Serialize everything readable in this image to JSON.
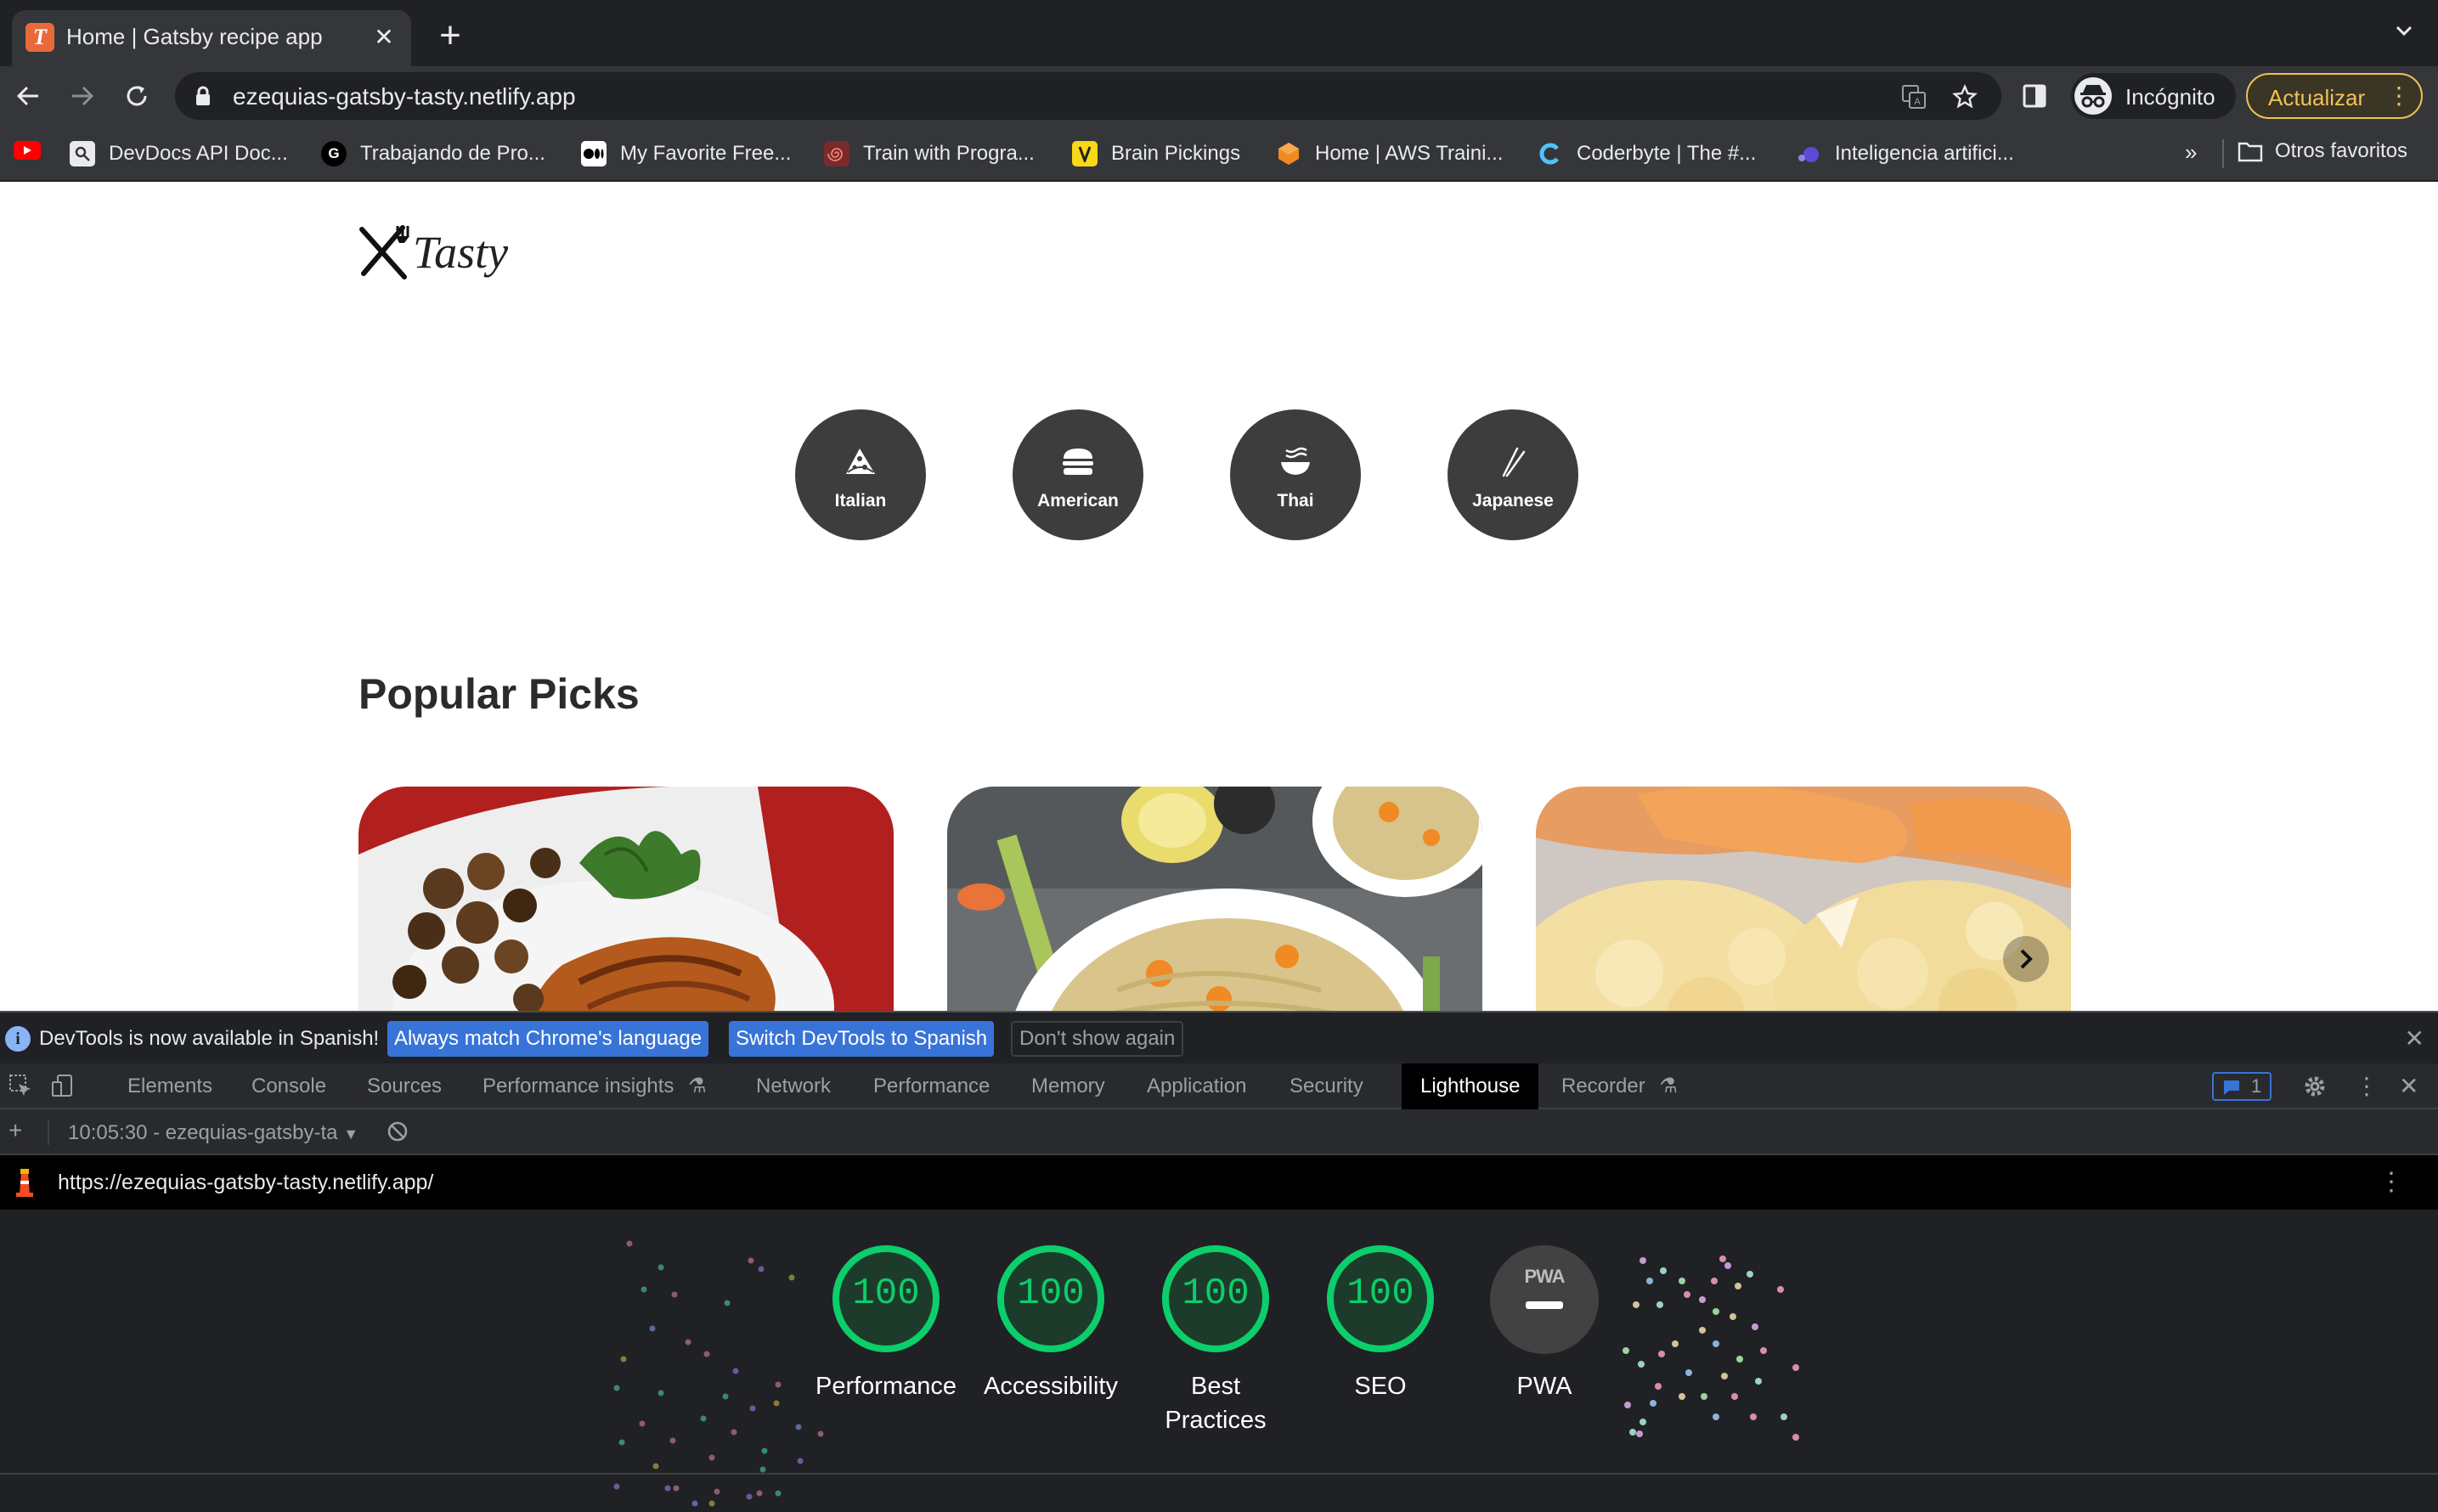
{
  "browser": {
    "tab": {
      "title": "Home | Gatsby recipe app",
      "favicon_letter": "T",
      "close": "✕"
    },
    "new_tab": "+",
    "url": "ezequias-gatsby-tasty.netlify.app",
    "profile": "Incógnito",
    "update_button": "Actualizar",
    "bookmarks": [
      {
        "label": "DevDocs API Doc...",
        "icon": "devdocs-icon"
      },
      {
        "label": "Trabajando de Pro...",
        "icon": "g-icon"
      },
      {
        "label": "My Favorite Free...",
        "icon": "medium-icon"
      },
      {
        "label": "Train with Progra...",
        "icon": "spiral-icon"
      },
      {
        "label": "Brain Pickings",
        "icon": "brainpickings-icon"
      },
      {
        "label": "Home | AWS Traini...",
        "icon": "aws-icon"
      },
      {
        "label": "Coderbyte | The #...",
        "icon": "coderbyte-icon"
      },
      {
        "label": "Inteligencia artifici...",
        "icon": "ai-icon"
      }
    ],
    "bookmarks_more": "»",
    "other_bookmarks": "Otros favoritos"
  },
  "site": {
    "logo_text": "Tasty",
    "cuisines": [
      {
        "label": "Italian",
        "icon": "pizza-icon"
      },
      {
        "label": "American",
        "icon": "burger-icon"
      },
      {
        "label": "Thai",
        "icon": "noodle-bowl-icon"
      },
      {
        "label": "Japanese",
        "icon": "chopsticks-icon"
      }
    ],
    "section_title": "Popular Picks"
  },
  "devtools": {
    "info_text": "DevTools is now available in Spanish!",
    "info_buttons": [
      "Always match Chrome's language",
      "Switch DevTools to Spanish",
      "Don't show again"
    ],
    "tabs": [
      "Elements",
      "Console",
      "Sources",
      "Performance insights",
      "Network",
      "Performance",
      "Memory",
      "Application",
      "Security",
      "Lighthouse",
      "Recorder"
    ],
    "active_tab": "Lighthouse",
    "issues_count": "1",
    "report_selector": "10:05:30 - ezequias-gatsby-ta",
    "report_url": "https://ezequias-gatsby-tasty.netlify.app/",
    "scores": [
      {
        "label": "Performance",
        "value": "100"
      },
      {
        "label": "Accessibility",
        "value": "100"
      },
      {
        "label": "Best Practices",
        "value": "100"
      },
      {
        "label": "SEO",
        "value": "100"
      }
    ],
    "pwa": {
      "label": "PWA",
      "badge": "PWA"
    }
  },
  "colors": {
    "score_pass": "#0cce6b",
    "accent_blue": "#3874d8",
    "update_yellow": "#f0c257",
    "cuisine_bg": "#3d3d3d"
  }
}
